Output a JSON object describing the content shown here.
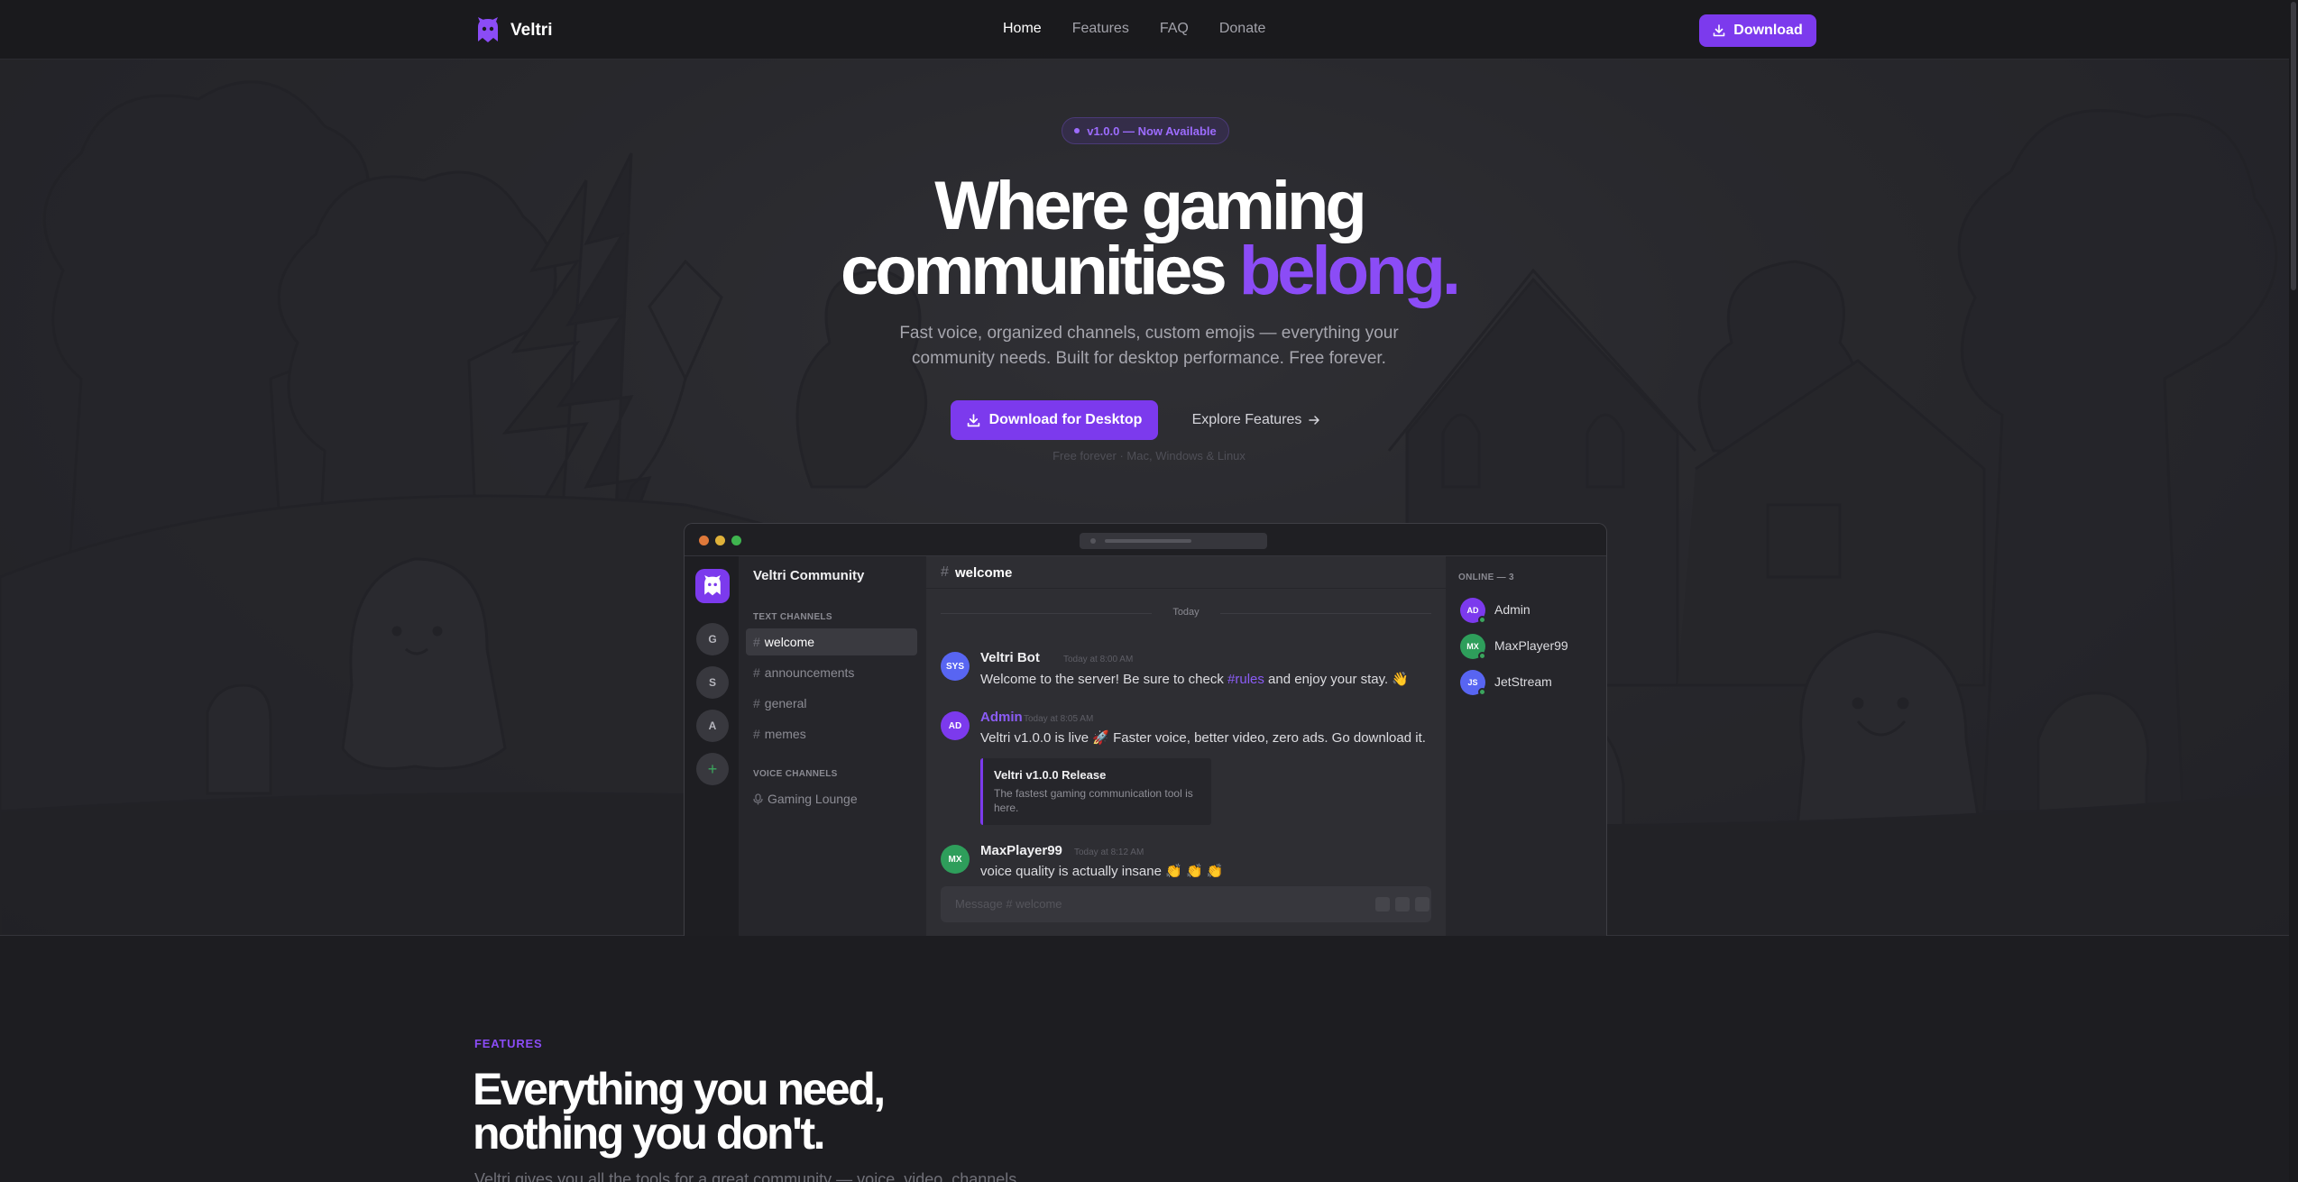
{
  "nav": {
    "brand": "Veltri",
    "links": [
      {
        "label": "Home",
        "active": true
      },
      {
        "label": "Features",
        "active": false
      },
      {
        "label": "FAQ",
        "active": false
      },
      {
        "label": "Donate",
        "active": false
      }
    ],
    "download_label": "Download"
  },
  "hero": {
    "badge": "v1.0.0 — Now Available",
    "headline_line1": "Where gaming",
    "headline_line2_a": "communities ",
    "headline_line2_accent": "belong.",
    "subtitle_line1": "Fast voice, organized channels, custom emojis — everything your",
    "subtitle_line2": "community needs. Built for desktop performance. Free forever.",
    "cta_primary": "Download for Desktop",
    "cta_secondary": "Explore Features",
    "note": "Free forever · Mac, Windows & Linux"
  },
  "mockup": {
    "servers": [
      {
        "label": "G"
      },
      {
        "label": "S"
      },
      {
        "label": "A"
      },
      {
        "label": "+"
      }
    ],
    "server_name": "Veltri Community",
    "text_category": "TEXT CHANNELS",
    "text_channels": [
      "welcome",
      "announcements",
      "general",
      "memes"
    ],
    "voice_category": "VOICE CHANNELS",
    "voice_channels": [
      "Gaming Lounge"
    ],
    "current_channel": "welcome",
    "day_label": "Today",
    "messages": [
      {
        "avatar": "SYS",
        "avatar_color": "#5865f2",
        "author": "Veltri Bot",
        "author_color": "#f0f0f2",
        "time": "Today at 8:00 AM",
        "text_before": "Welcome to the server! Be sure to check ",
        "link": "#rules",
        "text_after": " and enjoy your stay. 👋"
      },
      {
        "avatar": "AD",
        "avatar_color": "#7c3aed",
        "author": "Admin",
        "author_color": "#8b5cf6",
        "time": "Today at 8:05 AM",
        "text": "Veltri v1.0.0 is live 🚀 Faster voice, better video, zero ads. Go download it."
      },
      {
        "avatar": "MX",
        "avatar_color": "#2e9e5b",
        "author": "MaxPlayer99",
        "author_color": "#f0f0f2",
        "time": "Today at 8:12 AM",
        "text": "voice quality is actually insane 👏 👏 👏"
      }
    ],
    "embed": {
      "title": "Veltri v1.0.0 Release",
      "description": "The fastest gaming communication tool is here."
    },
    "composer_placeholder": "Message # welcome",
    "members_header": "ONLINE — 3",
    "members": [
      {
        "initials": "AD",
        "name": "Admin",
        "color": "#7c3aed"
      },
      {
        "initials": "MX",
        "name": "MaxPlayer99",
        "color": "#2e9e5b"
      },
      {
        "initials": "JS",
        "name": "JetStream",
        "color": "#5865f2"
      }
    ]
  },
  "features": {
    "label": "FEATURES",
    "title_line1": "Everything you need,",
    "title_line2": "nothing you don't.",
    "subtitle": "Veltri gives you all the tools for a great community — voice, video, channels"
  },
  "colors": {
    "accent": "#7c3aed",
    "accent_text": "#8b4cf6",
    "online": "#3ba55d"
  }
}
